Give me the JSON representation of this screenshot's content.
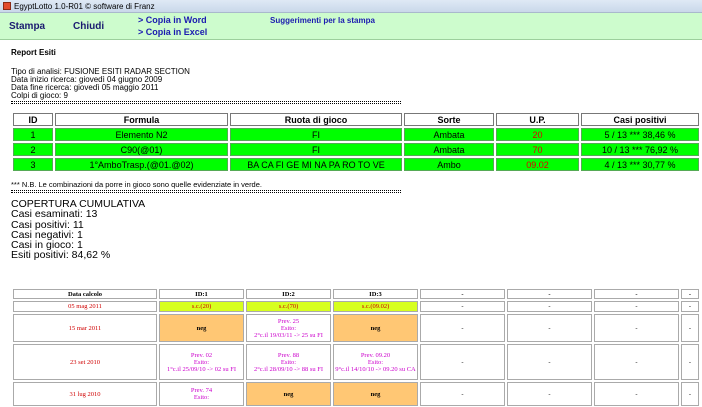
{
  "window": {
    "title": "EgyptLotto 1.0-R01  © software di Franz"
  },
  "toolbar": {
    "stampa": "Stampa",
    "chiudi": "Chiudi",
    "copia_word": "> Copia in Word",
    "copia_excel": "> Copia in Excel",
    "suggerimenti": "Suggerimenti per la stampa"
  },
  "report": {
    "title": "Report Esiti",
    "tipo_analisi": "Tipo di analisi: FUSIONE ESITI RADAR SECTION",
    "data_inizio": "Data inizio ricerca: giovedì 04 giugno 2009",
    "data_fine": "Data fine ricerca: giovedì 05 maggio 2011",
    "colpi": "Colpi di gioco: 9",
    "headers": [
      "ID",
      "Formula",
      "Ruota di gioco",
      "Sorte",
      "U.P.",
      "Casi positivi"
    ],
    "rows": [
      {
        "id": "1",
        "formula": "Elemento N2",
        "ruota": "FI",
        "sorte": "Ambata",
        "up": "20",
        "casi": "5 / 13 *** 38,46 %"
      },
      {
        "id": "2",
        "formula": "C90(@01)",
        "ruota": "FI",
        "sorte": "Ambata",
        "up": "70",
        "casi": "10 / 13 *** 76,92 %"
      },
      {
        "id": "3",
        "formula": "1°AmboTrasp.(@01.@02)",
        "ruota": "BA CA FI GE MI NA PA RO TO VE",
        "sorte": "Ambo",
        "up": "09.02",
        "casi": "4 / 13 *** 30,77 %"
      }
    ],
    "note": "*** N.B. Le combinazioni da porre in gioco sono quelle evidenziate in verde.",
    "copertura": {
      "title": "COPERTURA CUMULATIVA",
      "esaminati": "Casi esaminati: 13",
      "positivi": "Casi positivi: 11",
      "negativi": "Casi negativi: 1",
      "in_gioco": "Casi in gioco: 1",
      "esiti": "Esiti positivi: 84,62 %"
    }
  },
  "storico": {
    "headers": [
      "Data calcolo",
      "ID:1",
      "ID:2",
      "ID:3",
      "-",
      "-",
      "-",
      "-"
    ],
    "rows": [
      {
        "date": "05 mag 2011",
        "c1": "s.c.(20)",
        "c2": "s.c.(70)",
        "c3": "s.c.(09.02)"
      },
      {
        "date": "15 mar 2011",
        "c1": "neg",
        "c2a": "Prev. 25",
        "c2b": "Esito:",
        "c2c": "2°c.il 19/03/11 -> 25 su FI",
        "c3": "neg"
      },
      {
        "date": "23 set 2010",
        "c1a": "Prev. 02",
        "c1b": "Esito:",
        "c1c": "1°c.il 25/09/10 -> 02 su FI",
        "c2a": "Prev. 88",
        "c2b": "Esito:",
        "c2c": "2°c.il 28/09/10 -> 88 su FI",
        "c3a": "Prev. 09.20",
        "c3b": "Esito:",
        "c3c": "9°c.il 14/10/10 -> 09.20 su CA"
      },
      {
        "date": "31 lug 2010",
        "c1a": "Prev. 74",
        "c1b": "Esito:",
        "c2": "neg",
        "c3": "neg"
      }
    ],
    "dash": "-"
  }
}
